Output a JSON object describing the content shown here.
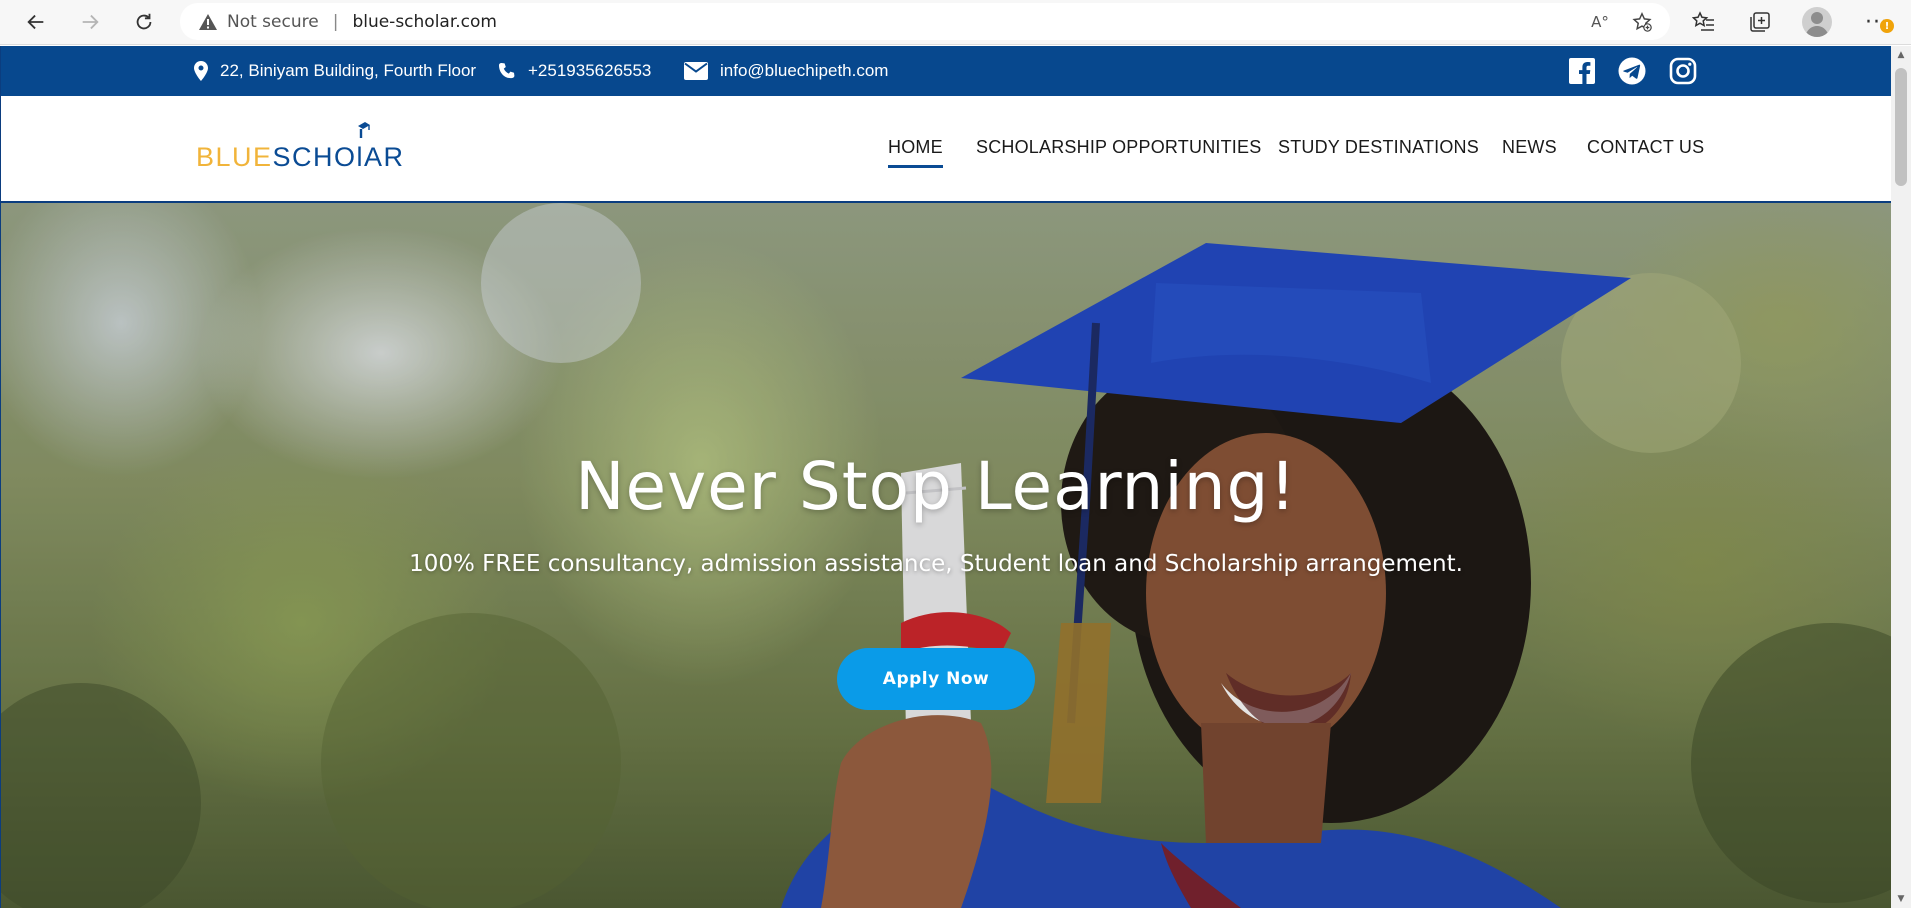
{
  "browser": {
    "security_label": "Not secure",
    "separator": "|",
    "url": "blue-scholar.com",
    "notification_badge": "!",
    "read_aloud_label": "A°"
  },
  "topbar": {
    "address": "22, Biniyam Building, Fourth Floor",
    "phone": "+251935626553",
    "email": "info@bluechipeth.com",
    "social_icons": [
      "facebook-icon",
      "telegram-icon",
      "instagram-icon"
    ],
    "background_color": "#07488e"
  },
  "logo": {
    "part1": "BLUE",
    "part2": "SCHOlAR",
    "part1_color": "#f1b43a",
    "part2_color": "#0a4b94"
  },
  "nav": {
    "items": [
      {
        "label": "HOME",
        "active": true
      },
      {
        "label": "SCHOLARSHIP OPPORTUNITIES",
        "active": false
      },
      {
        "label": "STUDY DESTINATIONS",
        "active": false
      },
      {
        "label": "NEWS",
        "active": false
      },
      {
        "label": "CONTACT US",
        "active": false
      }
    ]
  },
  "hero": {
    "title": "Never Stop Learning!",
    "subtitle": "100% FREE consultancy, admission assistance, Student loan and Scholarship arrangement.",
    "cta_label": "Apply Now",
    "cta_color": "#0a9be8"
  }
}
